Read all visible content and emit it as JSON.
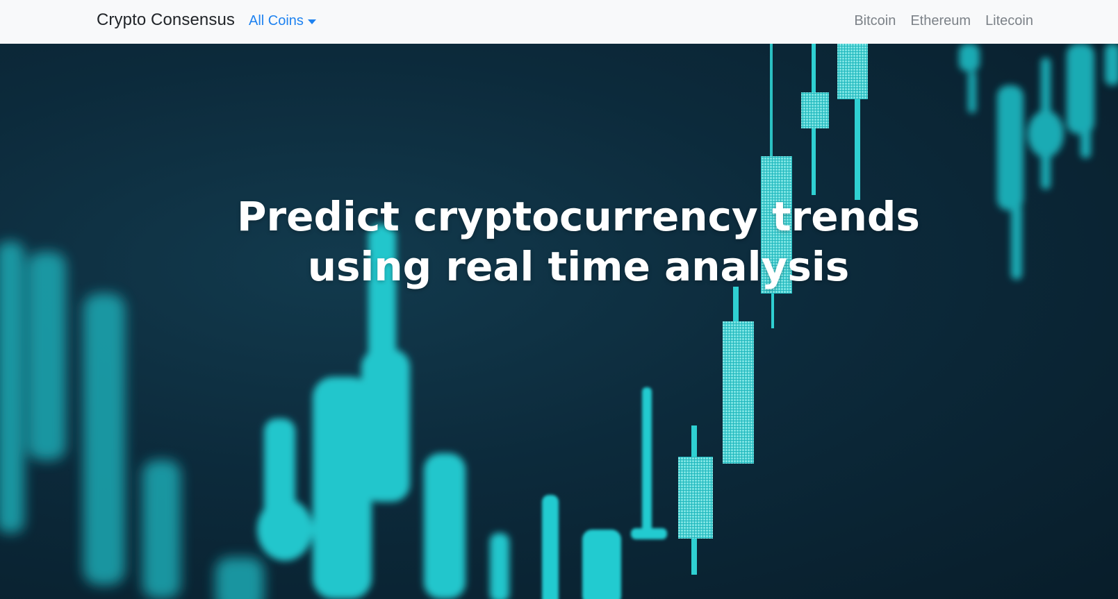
{
  "navbar": {
    "brand": "Crypto Consensus",
    "dropdown_label": "All Coins",
    "links": [
      "Bitcoin",
      "Ethereum",
      "Litecoin"
    ]
  },
  "hero": {
    "title": "Predict cryptocurrency trends using real time analysis"
  },
  "colors": {
    "accent": "#1e82f0",
    "navbar_bg": "#f8f9fa",
    "hero_bg": "#0c2a3b",
    "candle": "#1fc3c8"
  }
}
